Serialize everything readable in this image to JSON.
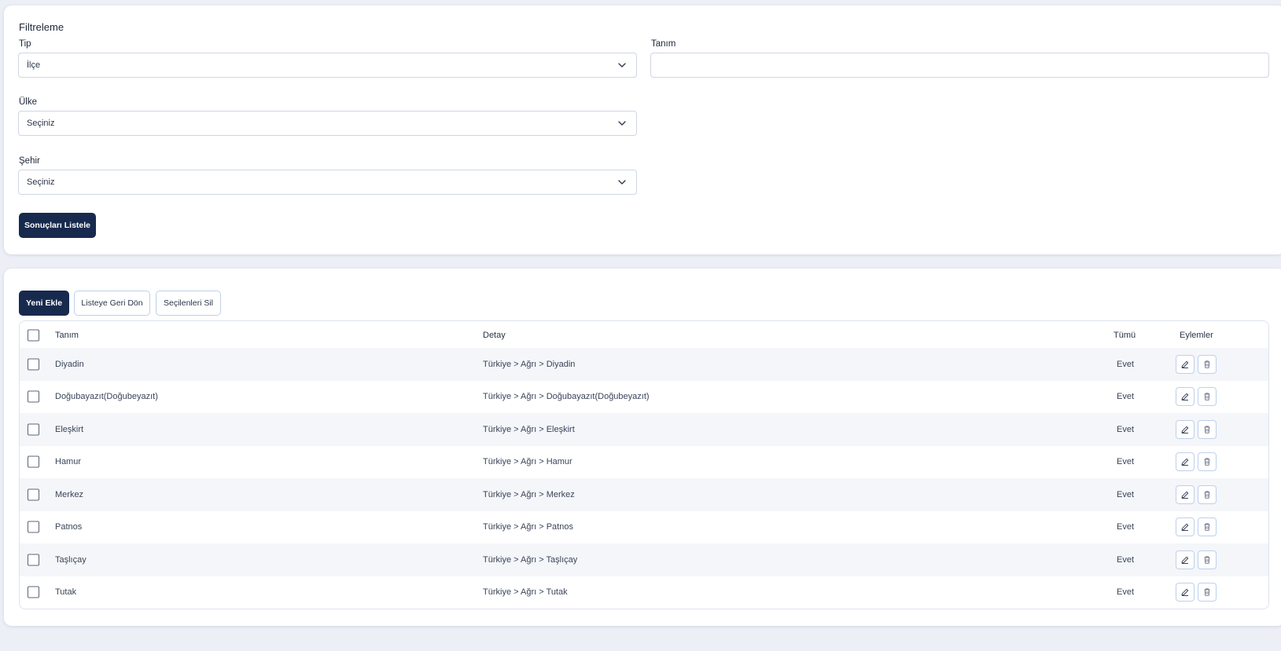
{
  "filter": {
    "title": "Filtreleme",
    "tip_label": "Tip",
    "tip_value": "İlçe",
    "tanim_label": "Tanım",
    "tanim_value": "",
    "ulke_label": "Ülke",
    "ulke_value": "Seçiniz",
    "sehir_label": "Şehir",
    "sehir_value": "Seçiniz",
    "submit_label": "Sonuçları Listele"
  },
  "toolbar": {
    "add_label": "Yeni Ekle",
    "back_label": "Listeye Geri Dön",
    "delete_selected_label": "Seçilenleri Sil"
  },
  "table": {
    "headers": [
      "Tanım",
      "Detay",
      "Tümü",
      "Eylemler"
    ],
    "rows": [
      {
        "tanim": "Diyadin",
        "detay": "Türkiye > Ağrı > Diyadin",
        "tumu": "Evet"
      },
      {
        "tanim": "Doğubayazıt(Doğubeyazıt)",
        "detay": "Türkiye > Ağrı > Doğubayazıt(Doğubeyazıt)",
        "tumu": "Evet"
      },
      {
        "tanim": "Eleşkirt",
        "detay": "Türkiye > Ağrı > Eleşkirt",
        "tumu": "Evet"
      },
      {
        "tanim": "Hamur",
        "detay": "Türkiye > Ağrı > Hamur",
        "tumu": "Evet"
      },
      {
        "tanim": "Merkez",
        "detay": "Türkiye > Ağrı > Merkez",
        "tumu": "Evet"
      },
      {
        "tanim": "Patnos",
        "detay": "Türkiye > Ağrı > Patnos",
        "tumu": "Evet"
      },
      {
        "tanim": "Taşlıçay",
        "detay": "Türkiye > Ağrı > Taşlıçay",
        "tumu": "Evet"
      },
      {
        "tanim": "Tutak",
        "detay": "Türkiye > Ağrı > Tutak",
        "tumu": "Evet"
      }
    ]
  },
  "icons": {
    "select_chevron": "chevron-down-icon",
    "edit": "pencil-icon",
    "delete": "trash-icon"
  },
  "colors": {
    "primary": "#172a4e",
    "page_bg": "#eceff6",
    "row_alt": "#f4f6f9",
    "outline": "#bfd0ea"
  }
}
